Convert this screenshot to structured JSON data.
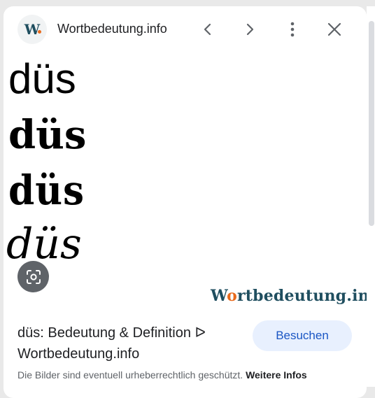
{
  "header": {
    "favicon_letter": "W",
    "site_name": "Wortbedeutung.info"
  },
  "icons": {
    "back": "chevron-left-icon",
    "forward": "chevron-right-icon",
    "more": "more-vert-icon",
    "close": "close-icon",
    "lens": "google-lens-icon"
  },
  "image": {
    "word_variants": [
      "düs",
      "düs",
      "düs",
      "düs"
    ],
    "brand_prefix": "W",
    "brand_o": "o",
    "brand_rest": "rtbedeutung.info"
  },
  "result": {
    "title": "düs: Bedeutung & Definition ᐅ Wortbedeutung.info",
    "visit_label": "Besuchen",
    "copyright_notice": "Die Bilder sind eventuell urheberrechtlich geschützt.",
    "more_info_label": "Weitere Infos"
  },
  "colors": {
    "brand": "#1f4e5f",
    "brand_accent": "#e86a1c",
    "button_bg": "#e8f0fe",
    "button_text": "#1a56c4"
  }
}
